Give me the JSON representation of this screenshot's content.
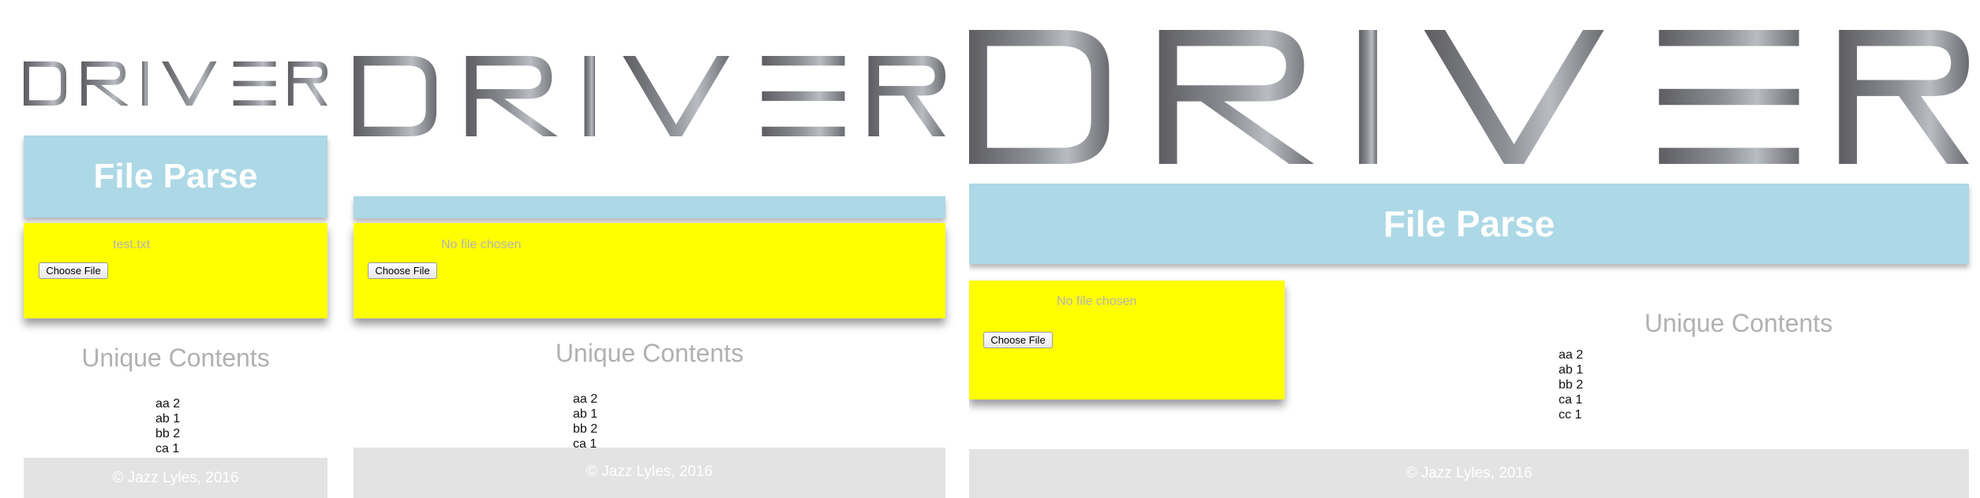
{
  "brand": {
    "logo_text": "DRIVER"
  },
  "views": [
    {
      "header": {
        "title": "File Parse"
      },
      "upload": {
        "file_name": "test.txt",
        "button_label": "Choose File"
      },
      "results": {
        "title": "Unique Contents",
        "items": [
          "aa 2",
          "ab 1",
          "bb 2",
          "ca 1"
        ]
      },
      "footer": {
        "text": "© Jazz Lyles, 2016"
      }
    },
    {
      "header": {
        "title": ""
      },
      "upload": {
        "file_name": "No file chosen",
        "button_label": "Choose File"
      },
      "results": {
        "title": "Unique Contents",
        "items": [
          "aa 2",
          "ab 1",
          "bb 2",
          "ca 1"
        ]
      },
      "footer": {
        "text": "© Jazz Lyles, 2016"
      }
    },
    {
      "header": {
        "title": "File Parse"
      },
      "upload": {
        "file_name": "No file chosen",
        "button_label": "Choose File"
      },
      "results": {
        "title": "Unique Contents",
        "items": [
          "aa 2",
          "ab 1",
          "bb 2",
          "ca 1",
          "cc 1"
        ]
      },
      "footer": {
        "text": "© Jazz Lyles, 2016"
      }
    }
  ],
  "colors": {
    "header_bg": "#add8e6",
    "upload_bg": "#ffff00",
    "footer_bg": "#e3e3e3",
    "muted_text": "#b1b1b1",
    "logo_dark": "#5e5e62",
    "logo_light": "#b9bcc1"
  }
}
